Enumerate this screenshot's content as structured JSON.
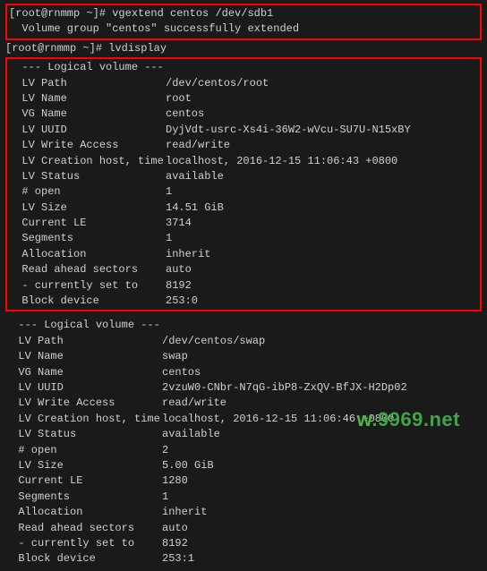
{
  "prompt1": {
    "user": "[root@rnmmp ~]# ",
    "cmd": "vgextend centos /dev/sdb1",
    "output": "  Volume group \"centos\" successfully extended"
  },
  "prompt2": {
    "user": "[root@rnmmp ~]# ",
    "cmd": "lvdisplay"
  },
  "lv1": {
    "heading": "  --- Logical volume ---",
    "rows": [
      {
        "label": "  LV Path",
        "value": "/dev/centos/root"
      },
      {
        "label": "  LV Name",
        "value": "root"
      },
      {
        "label": "  VG Name",
        "value": "centos"
      },
      {
        "label": "  LV UUID",
        "value": "DyjVdt-usrc-Xs4i-36W2-wVcu-SU7U-N15xBY"
      },
      {
        "label": "  LV Write Access",
        "value": "read/write"
      },
      {
        "label": "  LV Creation host, time",
        "value": "localhost, 2016-12-15 11:06:43 +0800"
      },
      {
        "label": "  LV Status",
        "value": "available"
      },
      {
        "label": "  # open",
        "value": "1"
      },
      {
        "label": "  LV Size",
        "value": "14.51 GiB"
      },
      {
        "label": "  Current LE",
        "value": "3714"
      },
      {
        "label": "  Segments",
        "value": "1"
      },
      {
        "label": "  Allocation",
        "value": "inherit"
      },
      {
        "label": "  Read ahead sectors",
        "value": "auto"
      },
      {
        "label": "  - currently set to",
        "value": "8192"
      },
      {
        "label": "  Block device",
        "value": "253:0"
      }
    ]
  },
  "lv2": {
    "heading": "  --- Logical volume ---",
    "rows": [
      {
        "label": "  LV Path",
        "value": "/dev/centos/swap"
      },
      {
        "label": "  LV Name",
        "value": "swap"
      },
      {
        "label": "  VG Name",
        "value": "centos"
      },
      {
        "label": "  LV UUID",
        "value": "2vzuW0-CNbr-N7qG-ibP8-ZxQV-BfJX-H2Dp02"
      },
      {
        "label": "  LV Write Access",
        "value": "read/write"
      },
      {
        "label": "  LV Creation host, time",
        "value": "localhost, 2016-12-15 11:06:46 +0800"
      },
      {
        "label": "  LV Status",
        "value": "available"
      },
      {
        "label": "  # open",
        "value": "2"
      },
      {
        "label": "  LV Size",
        "value": "5.00 GiB"
      },
      {
        "label": "  Current LE",
        "value": "1280"
      },
      {
        "label": "  Segments",
        "value": "1"
      },
      {
        "label": "  Allocation",
        "value": "inherit"
      },
      {
        "label": "  Read ahead sectors",
        "value": "auto"
      },
      {
        "label": "  - currently set to",
        "value": "8192"
      },
      {
        "label": "  Block device",
        "value": "253:1"
      }
    ]
  },
  "watermark": "w.9969.net"
}
